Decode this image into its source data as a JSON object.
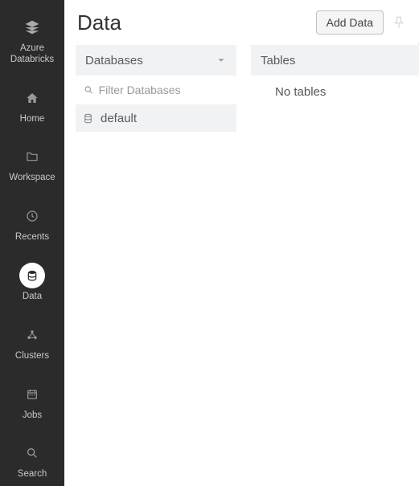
{
  "sidebar": {
    "brand_label": "Azure\nDatabricks",
    "items": [
      {
        "label": "Home"
      },
      {
        "label": "Workspace"
      },
      {
        "label": "Recents"
      },
      {
        "label": "Data"
      },
      {
        "label": "Clusters"
      },
      {
        "label": "Jobs"
      },
      {
        "label": "Search"
      }
    ]
  },
  "page": {
    "title": "Data",
    "add_button": "Add Data"
  },
  "databases": {
    "header": "Databases",
    "filter_placeholder": "Filter Databases",
    "items": [
      {
        "name": "default"
      }
    ]
  },
  "tables": {
    "header": "Tables",
    "empty": "No tables"
  }
}
